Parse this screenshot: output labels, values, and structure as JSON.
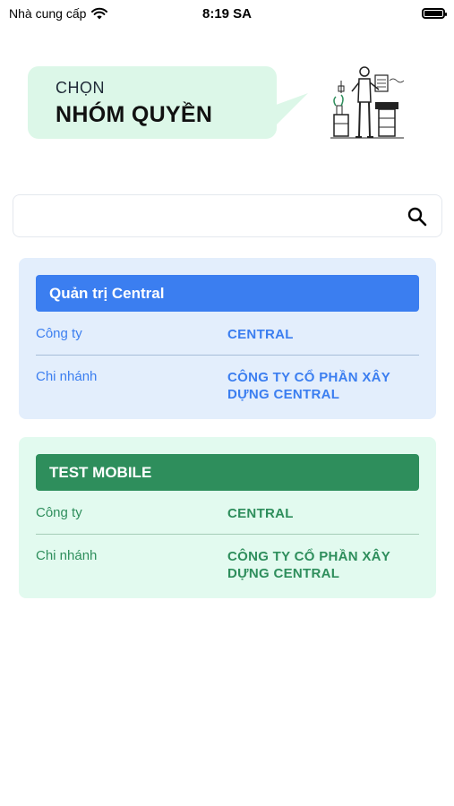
{
  "status_bar": {
    "carrier": "Nhà cung cấp",
    "time": "8:19 SA"
  },
  "header": {
    "subtitle": "CHỌN",
    "title": "NHÓM QUYỀN"
  },
  "search": {
    "placeholder": "",
    "value": ""
  },
  "groups": [
    {
      "name": "Quản trị Central",
      "company_label": "Công ty",
      "company_value": "CENTRAL",
      "branch_label": "Chi nhánh",
      "branch_value": "CÔNG TY CỔ PHẦN XÂY DỰNG CENTRAL",
      "accent": "#3b7ef0"
    },
    {
      "name": "TEST MOBILE",
      "company_label": "Công ty",
      "company_value": "CENTRAL",
      "branch_label": "Chi nhánh",
      "branch_value": "CÔNG TY CỔ PHẦN XÂY DỰNG CENTRAL",
      "accent": "#2e8e5c"
    }
  ],
  "icons": {
    "wifi": "wifi-icon",
    "battery": "battery-icon",
    "search": "search-icon",
    "illustration": "office-worker-illustration"
  }
}
